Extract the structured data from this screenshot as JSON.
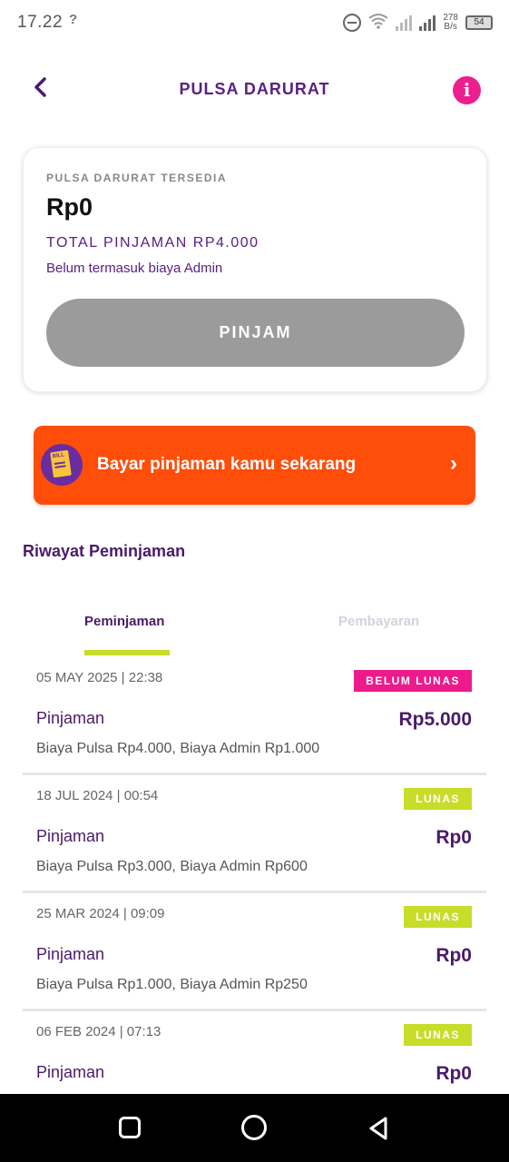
{
  "status_bar": {
    "time": "17.22",
    "time_icon": "?",
    "net_speed_value": "278",
    "net_speed_unit": "B/s",
    "battery": "54"
  },
  "header": {
    "title": "PULSA DARURAT",
    "back_icon": "‹",
    "info_icon": "i"
  },
  "card": {
    "label": "PULSA DARURAT TERSEDIA",
    "amount": "Rp0",
    "total": "TOTAL PINJAMAN RP4.000",
    "note": "Belum termasuk biaya Admin",
    "button_label": "PINJAM"
  },
  "banner": {
    "text": "Bayar pinjaman kamu sekarang",
    "chevron": "›"
  },
  "history": {
    "title": "Riwayat Peminjaman",
    "tabs": [
      "Peminjaman",
      "Pembayaran"
    ],
    "rows": [
      {
        "date": "05 MAY 2025 | 22:38",
        "status": "BELUM LUNAS",
        "type": "Pinjaman",
        "amount": "Rp5.000",
        "desc": "Biaya Pulsa Rp4.000, Biaya Admin Rp1.000"
      },
      {
        "date": "18 JUL 2024 | 00:54",
        "status": "LUNAS",
        "type": "Pinjaman",
        "amount": "Rp0",
        "desc": "Biaya Pulsa Rp3.000, Biaya Admin Rp600"
      },
      {
        "date": "25 MAR 2024 | 09:09",
        "status": "LUNAS",
        "type": "Pinjaman",
        "amount": "Rp0",
        "desc": "Biaya Pulsa Rp1.000, Biaya Admin Rp250"
      },
      {
        "date": "06 FEB 2024 | 07:13",
        "status": "LUNAS",
        "type": "Pinjaman",
        "amount": "Rp0",
        "desc": ""
      }
    ]
  },
  "colors": {
    "brand_purple": "#4a1a6b",
    "pink": "#ec1a8b",
    "lime": "#c8dc2a",
    "orange": "#ff4e0a",
    "disabled_grey": "#9b9b9b"
  }
}
